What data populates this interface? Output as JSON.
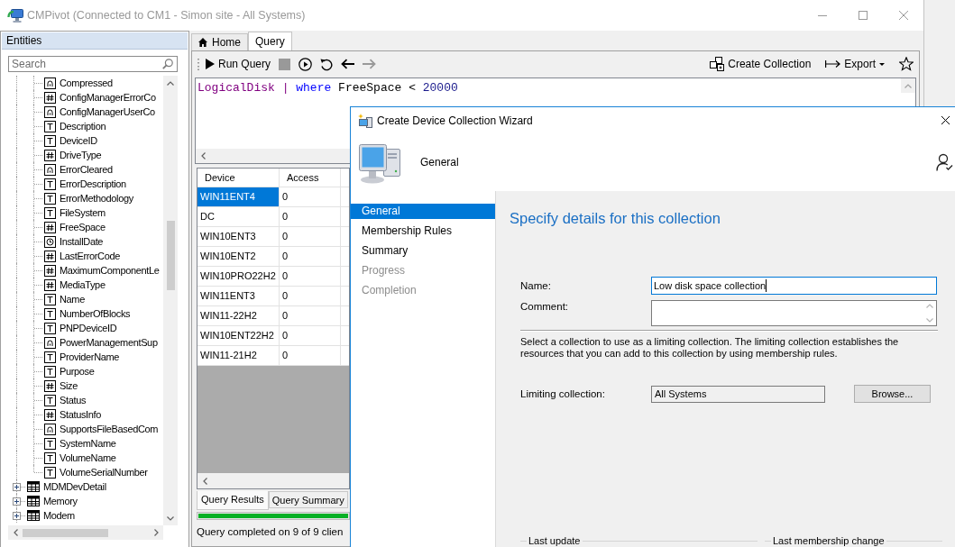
{
  "window": {
    "title": "CMPivot (Connected to CM1 - Simon site - All Systems)"
  },
  "entities": {
    "header": "Entities",
    "search": {
      "placeholder": "Search"
    },
    "items": [
      {
        "children": [
          {
            "label": "Compressed",
            "kind": "bool"
          },
          {
            "label": "ConfigManagerErrorCo",
            "kind": "number"
          },
          {
            "label": "ConfigManagerUserCo",
            "kind": "bool"
          },
          {
            "label": "Description",
            "kind": "text"
          },
          {
            "label": "DeviceID",
            "kind": "text"
          },
          {
            "label": "DriveType",
            "kind": "number"
          },
          {
            "label": "ErrorCleared",
            "kind": "bool"
          },
          {
            "label": "ErrorDescription",
            "kind": "text"
          },
          {
            "label": "ErrorMethodology",
            "kind": "text"
          },
          {
            "label": "FileSystem",
            "kind": "text"
          },
          {
            "label": "FreeSpace",
            "kind": "number"
          },
          {
            "label": "InstallDate",
            "kind": "date"
          },
          {
            "label": "LastErrorCode",
            "kind": "number"
          },
          {
            "label": "MaximumComponentLe",
            "kind": "number"
          },
          {
            "label": "MediaType",
            "kind": "number"
          },
          {
            "label": "Name",
            "kind": "text"
          },
          {
            "label": "NumberOfBlocks",
            "kind": "text"
          },
          {
            "label": "PNPDeviceID",
            "kind": "text"
          },
          {
            "label": "PowerManagementSup",
            "kind": "bool"
          },
          {
            "label": "ProviderName",
            "kind": "text"
          },
          {
            "label": "Purpose",
            "kind": "text"
          },
          {
            "label": "Size",
            "kind": "number"
          },
          {
            "label": "Status",
            "kind": "text"
          },
          {
            "label": "StatusInfo",
            "kind": "number"
          },
          {
            "label": "SupportsFileBasedCom",
            "kind": "bool"
          },
          {
            "label": "SystemName",
            "kind": "text"
          },
          {
            "label": "VolumeName",
            "kind": "text"
          },
          {
            "label": "VolumeSerialNumber",
            "kind": "text"
          }
        ]
      },
      {
        "label": "MDMDevDetail",
        "kind": "table",
        "expanded": false
      },
      {
        "label": "Memory",
        "kind": "table",
        "expanded": false
      },
      {
        "label": "Modem",
        "kind": "table",
        "expanded": false
      }
    ]
  },
  "tabs": [
    {
      "label": "Home",
      "kind": "home",
      "selected": false
    },
    {
      "label": "Query",
      "kind": "plain",
      "selected": true
    }
  ],
  "toolbar": {
    "left": [
      {
        "kind": "run",
        "label": "Run Query",
        "disabled": false
      },
      {
        "kind": "stop",
        "disabled": true
      },
      {
        "kind": "step",
        "disabled": false
      },
      {
        "kind": "undo",
        "disabled": false
      },
      {
        "kind": "back",
        "disabled": false
      },
      {
        "kind": "forward",
        "disabled": true
      }
    ],
    "right": [
      {
        "kind": "collection",
        "label": "Create Collection"
      },
      {
        "kind": "export",
        "label": "Export"
      },
      {
        "kind": "star"
      }
    ]
  },
  "query": {
    "tokens": [
      {
        "text": "LogicalDisk",
        "kind": "entity"
      },
      {
        "text": "|",
        "kind": "operator"
      },
      {
        "text": "where",
        "kind": "keyword"
      },
      {
        "text": "FreeSpace",
        "kind": "name"
      },
      {
        "text": "<",
        "kind": "name"
      },
      {
        "text": "20000",
        "kind": "number"
      }
    ]
  },
  "results": {
    "columns": [
      "Device",
      "Access"
    ],
    "rows": [
      {
        "cells": [
          "WIN11ENT4",
          "0"
        ],
        "selected": true
      },
      {
        "cells": [
          "DC",
          "0"
        ],
        "selected": false
      },
      {
        "cells": [
          "WIN10ENT3",
          "0"
        ],
        "selected": false
      },
      {
        "cells": [
          "WIN10ENT2",
          "0"
        ],
        "selected": false
      },
      {
        "cells": [
          "WIN10PRO22H2",
          "0"
        ],
        "selected": false
      },
      {
        "cells": [
          "WIN11ENT3",
          "0"
        ],
        "selected": false
      },
      {
        "cells": [
          "WIN11-22H2",
          "0"
        ],
        "selected": false
      },
      {
        "cells": [
          "WIN10ENT22H2",
          "0"
        ],
        "selected": false
      },
      {
        "cells": [
          "WIN11-21H2",
          "0"
        ],
        "selected": false
      }
    ]
  },
  "result_tabs": [
    {
      "label": "Query Results",
      "selected": true
    },
    {
      "label": "Query Summary",
      "selected": false
    }
  ],
  "progress": {
    "level": 1
  },
  "status_bar": "Query completed on 9 of 9 clien",
  "wizard": {
    "title": "Create Device Collection Wizard",
    "page": "General",
    "steps": [
      {
        "label": "General",
        "selected": true,
        "disabled": false
      },
      {
        "label": "Membership Rules",
        "selected": false,
        "disabled": false
      },
      {
        "label": "Summary",
        "selected": false,
        "disabled": false
      },
      {
        "label": "Progress",
        "selected": false,
        "disabled": true
      },
      {
        "label": "Completion",
        "selected": false,
        "disabled": true
      }
    ],
    "heading": "Specify details for this collection",
    "fields": [
      {
        "kind": "line",
        "label": "Name:",
        "value": "Low disk space collection",
        "focused": true
      },
      {
        "kind": "multiline",
        "label": "Comment:",
        "focused": false
      }
    ],
    "description": "Select a collection to use as a limiting collection. The limiting collection establishes the resources that you can add to this collection by using membership rules.",
    "limiting": {
      "label": "Limiting collection:",
      "value": "All Systems",
      "readonly": true,
      "button": "Browse..."
    },
    "groups": [
      "Last update",
      "Last membership change"
    ]
  }
}
